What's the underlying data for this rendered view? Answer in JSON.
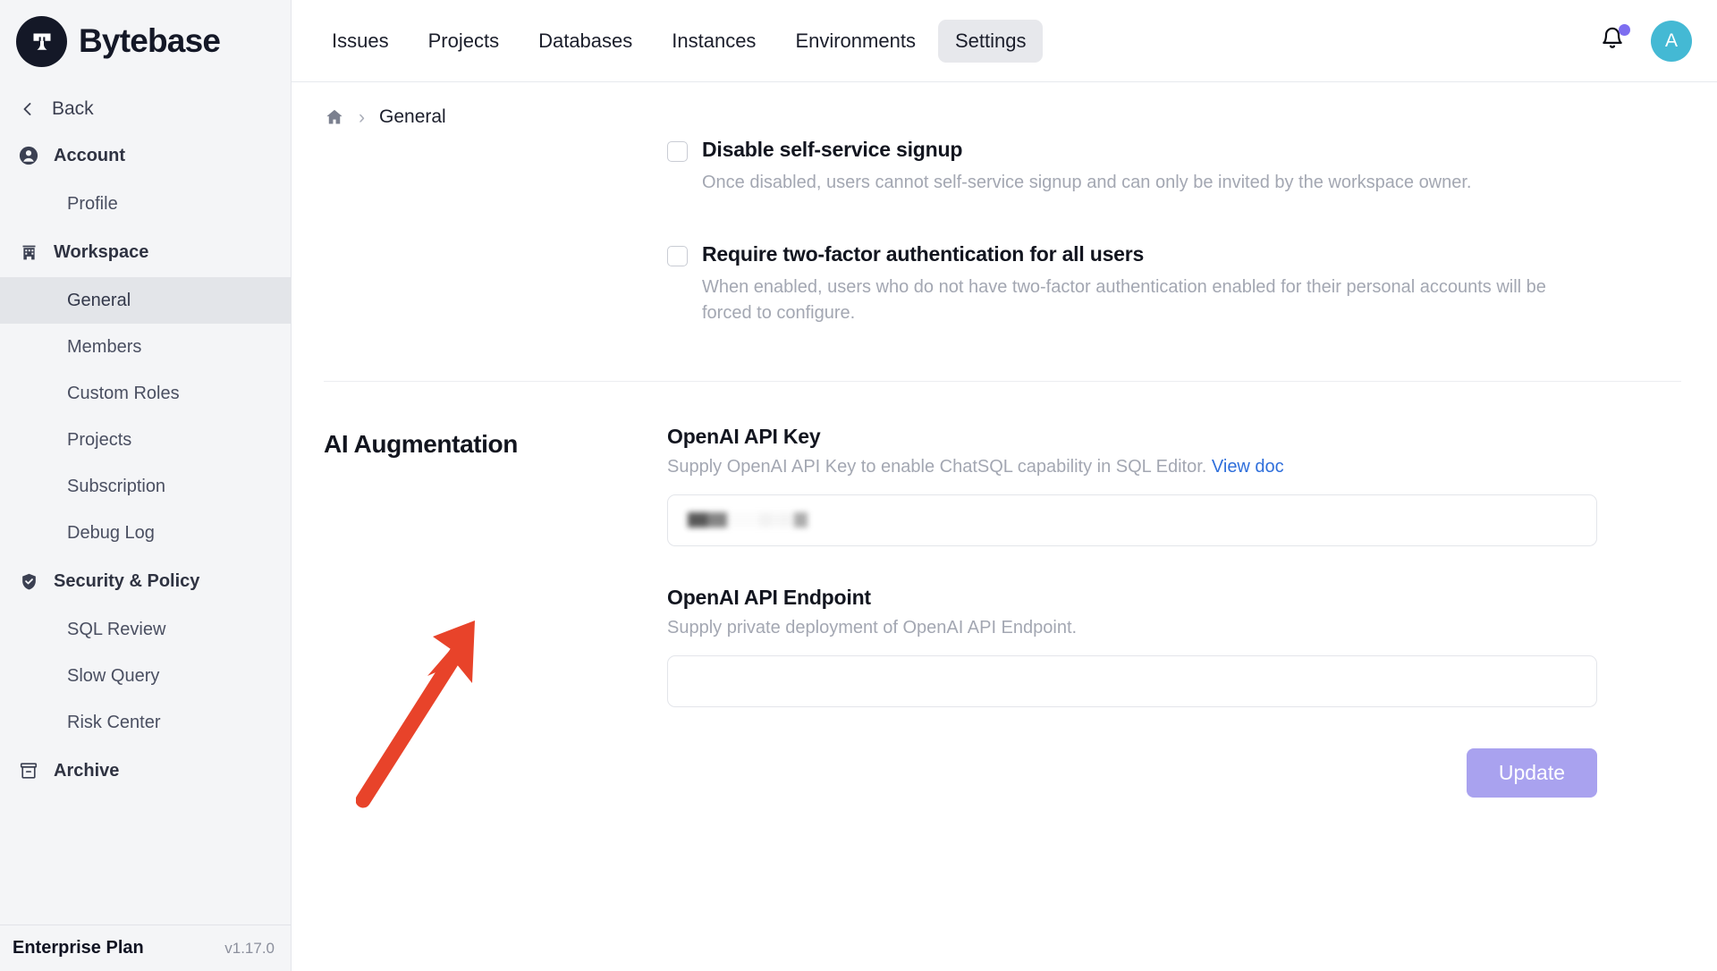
{
  "brand": {
    "name": "Bytebase",
    "logo_icon": "bytebase-logo-icon"
  },
  "sidebar": {
    "back_label": "Back",
    "back_icon": "chevron-left-icon",
    "groups": [
      {
        "label": "Account",
        "icon": "user-circle-icon",
        "items": [
          {
            "label": "Profile",
            "active": false
          }
        ]
      },
      {
        "label": "Workspace",
        "icon": "building-icon",
        "items": [
          {
            "label": "General",
            "active": true
          },
          {
            "label": "Members",
            "active": false
          },
          {
            "label": "Custom Roles",
            "active": false
          },
          {
            "label": "Projects",
            "active": false
          },
          {
            "label": "Subscription",
            "active": false
          },
          {
            "label": "Debug Log",
            "active": false
          }
        ]
      },
      {
        "label": "Security & Policy",
        "icon": "shield-check-icon",
        "items": [
          {
            "label": "SQL Review",
            "active": false
          },
          {
            "label": "Slow Query",
            "active": false
          },
          {
            "label": "Risk Center",
            "active": false
          }
        ]
      },
      {
        "label": "Archive",
        "icon": "archive-box-icon",
        "items": []
      }
    ],
    "footer": {
      "plan": "Enterprise Plan",
      "version": "v1.17.0"
    }
  },
  "topbar": {
    "tabs": [
      {
        "label": "Issues",
        "active": false
      },
      {
        "label": "Projects",
        "active": false
      },
      {
        "label": "Databases",
        "active": false
      },
      {
        "label": "Instances",
        "active": false
      },
      {
        "label": "Environments",
        "active": false
      },
      {
        "label": "Settings",
        "active": true
      }
    ],
    "notification_icon": "bell-icon",
    "notification_dot_color": "#7d6ef0",
    "avatar_initial": "A",
    "avatar_color": "#44b9d4"
  },
  "breadcrumb": {
    "home_icon": "home-icon",
    "separator": "›",
    "current": "General"
  },
  "settings": {
    "checkboxes": [
      {
        "title": "Disable self-service signup",
        "description": "Once disabled, users cannot self-service signup and can only be invited by the workspace owner.",
        "checked": false
      },
      {
        "title": "Require two-factor authentication for all users",
        "description": "When enabled, users who do not have two-factor authentication enabled for their personal accounts will be forced to configure.",
        "checked": false
      }
    ],
    "ai_section": {
      "heading": "AI Augmentation",
      "api_key": {
        "label": "OpenAI API Key",
        "help_prefix": "Supply OpenAI API Key to enable ChatSQL capability in SQL Editor.",
        "help_link": "View doc",
        "value": "sk-xxxxxxxx",
        "masked": true,
        "placeholder": ""
      },
      "api_endpoint": {
        "label": "OpenAI API Endpoint",
        "help": "Supply private deployment of OpenAI API Endpoint.",
        "value": "",
        "placeholder": ""
      },
      "update_button": "Update",
      "update_button_color": "#a9a2ef"
    }
  },
  "annotation": {
    "arrow_color": "#e8432a",
    "arrow_name": "red-pointer-arrow"
  }
}
